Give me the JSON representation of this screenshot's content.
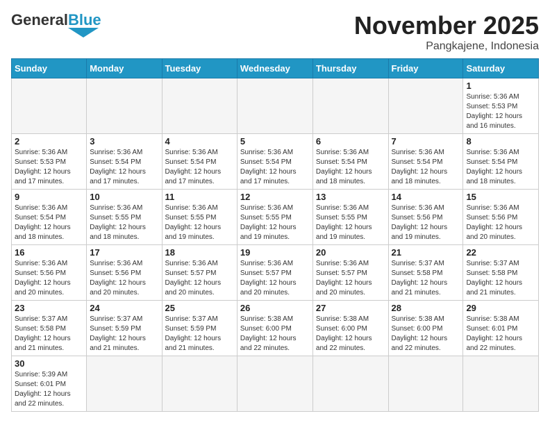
{
  "logo": {
    "text_general": "General",
    "text_blue": "Blue"
  },
  "title": "November 2025",
  "location": "Pangkajene, Indonesia",
  "days_of_week": [
    "Sunday",
    "Monday",
    "Tuesday",
    "Wednesday",
    "Thursday",
    "Friday",
    "Saturday"
  ],
  "weeks": [
    [
      {
        "day": "",
        "info": ""
      },
      {
        "day": "",
        "info": ""
      },
      {
        "day": "",
        "info": ""
      },
      {
        "day": "",
        "info": ""
      },
      {
        "day": "",
        "info": ""
      },
      {
        "day": "",
        "info": ""
      },
      {
        "day": "1",
        "info": "Sunrise: 5:36 AM\nSunset: 5:53 PM\nDaylight: 12 hours\nand 16 minutes."
      }
    ],
    [
      {
        "day": "2",
        "info": "Sunrise: 5:36 AM\nSunset: 5:53 PM\nDaylight: 12 hours\nand 17 minutes."
      },
      {
        "day": "3",
        "info": "Sunrise: 5:36 AM\nSunset: 5:54 PM\nDaylight: 12 hours\nand 17 minutes."
      },
      {
        "day": "4",
        "info": "Sunrise: 5:36 AM\nSunset: 5:54 PM\nDaylight: 12 hours\nand 17 minutes."
      },
      {
        "day": "5",
        "info": "Sunrise: 5:36 AM\nSunset: 5:54 PM\nDaylight: 12 hours\nand 17 minutes."
      },
      {
        "day": "6",
        "info": "Sunrise: 5:36 AM\nSunset: 5:54 PM\nDaylight: 12 hours\nand 18 minutes."
      },
      {
        "day": "7",
        "info": "Sunrise: 5:36 AM\nSunset: 5:54 PM\nDaylight: 12 hours\nand 18 minutes."
      },
      {
        "day": "8",
        "info": "Sunrise: 5:36 AM\nSunset: 5:54 PM\nDaylight: 12 hours\nand 18 minutes."
      }
    ],
    [
      {
        "day": "9",
        "info": "Sunrise: 5:36 AM\nSunset: 5:54 PM\nDaylight: 12 hours\nand 18 minutes."
      },
      {
        "day": "10",
        "info": "Sunrise: 5:36 AM\nSunset: 5:55 PM\nDaylight: 12 hours\nand 18 minutes."
      },
      {
        "day": "11",
        "info": "Sunrise: 5:36 AM\nSunset: 5:55 PM\nDaylight: 12 hours\nand 19 minutes."
      },
      {
        "day": "12",
        "info": "Sunrise: 5:36 AM\nSunset: 5:55 PM\nDaylight: 12 hours\nand 19 minutes."
      },
      {
        "day": "13",
        "info": "Sunrise: 5:36 AM\nSunset: 5:55 PM\nDaylight: 12 hours\nand 19 minutes."
      },
      {
        "day": "14",
        "info": "Sunrise: 5:36 AM\nSunset: 5:56 PM\nDaylight: 12 hours\nand 19 minutes."
      },
      {
        "day": "15",
        "info": "Sunrise: 5:36 AM\nSunset: 5:56 PM\nDaylight: 12 hours\nand 20 minutes."
      }
    ],
    [
      {
        "day": "16",
        "info": "Sunrise: 5:36 AM\nSunset: 5:56 PM\nDaylight: 12 hours\nand 20 minutes."
      },
      {
        "day": "17",
        "info": "Sunrise: 5:36 AM\nSunset: 5:56 PM\nDaylight: 12 hours\nand 20 minutes."
      },
      {
        "day": "18",
        "info": "Sunrise: 5:36 AM\nSunset: 5:57 PM\nDaylight: 12 hours\nand 20 minutes."
      },
      {
        "day": "19",
        "info": "Sunrise: 5:36 AM\nSunset: 5:57 PM\nDaylight: 12 hours\nand 20 minutes."
      },
      {
        "day": "20",
        "info": "Sunrise: 5:36 AM\nSunset: 5:57 PM\nDaylight: 12 hours\nand 20 minutes."
      },
      {
        "day": "21",
        "info": "Sunrise: 5:37 AM\nSunset: 5:58 PM\nDaylight: 12 hours\nand 21 minutes."
      },
      {
        "day": "22",
        "info": "Sunrise: 5:37 AM\nSunset: 5:58 PM\nDaylight: 12 hours\nand 21 minutes."
      }
    ],
    [
      {
        "day": "23",
        "info": "Sunrise: 5:37 AM\nSunset: 5:58 PM\nDaylight: 12 hours\nand 21 minutes."
      },
      {
        "day": "24",
        "info": "Sunrise: 5:37 AM\nSunset: 5:59 PM\nDaylight: 12 hours\nand 21 minutes."
      },
      {
        "day": "25",
        "info": "Sunrise: 5:37 AM\nSunset: 5:59 PM\nDaylight: 12 hours\nand 21 minutes."
      },
      {
        "day": "26",
        "info": "Sunrise: 5:38 AM\nSunset: 6:00 PM\nDaylight: 12 hours\nand 22 minutes."
      },
      {
        "day": "27",
        "info": "Sunrise: 5:38 AM\nSunset: 6:00 PM\nDaylight: 12 hours\nand 22 minutes."
      },
      {
        "day": "28",
        "info": "Sunrise: 5:38 AM\nSunset: 6:00 PM\nDaylight: 12 hours\nand 22 minutes."
      },
      {
        "day": "29",
        "info": "Sunrise: 5:38 AM\nSunset: 6:01 PM\nDaylight: 12 hours\nand 22 minutes."
      }
    ],
    [
      {
        "day": "30",
        "info": "Sunrise: 5:39 AM\nSunset: 6:01 PM\nDaylight: 12 hours\nand 22 minutes."
      },
      {
        "day": "",
        "info": ""
      },
      {
        "day": "",
        "info": ""
      },
      {
        "day": "",
        "info": ""
      },
      {
        "day": "",
        "info": ""
      },
      {
        "day": "",
        "info": ""
      },
      {
        "day": "",
        "info": ""
      }
    ]
  ]
}
